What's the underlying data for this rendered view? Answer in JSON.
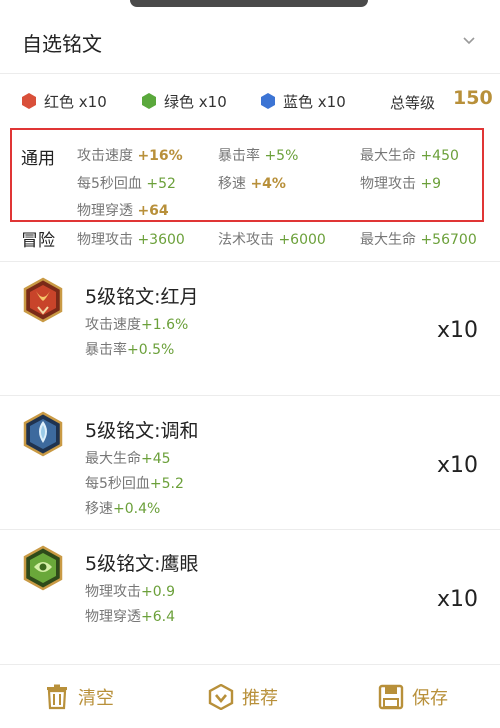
{
  "header": {
    "title": "自选铭文"
  },
  "colors": [
    {
      "label": "红色 x10",
      "color": "#d9503a"
    },
    {
      "label": "绿色 x10",
      "color": "#5aa83c"
    },
    {
      "label": "蓝色 x10",
      "color": "#3c74d4"
    }
  ],
  "level": {
    "label": "总等级",
    "value": "150"
  },
  "general": {
    "title": "通用",
    "stats": [
      {
        "label": "攻击速度",
        "value": "+16%"
      },
      {
        "label": "暴击率",
        "value": "+5%"
      },
      {
        "label": "最大生命",
        "value": "+450"
      },
      {
        "label": "每5秒回血",
        "value": "+52"
      },
      {
        "label": "移速",
        "value": "+4%"
      },
      {
        "label": "物理攻击",
        "value": "+9"
      },
      {
        "label": "物理穿透",
        "value": "+64"
      }
    ]
  },
  "adventure": {
    "title": "冒险",
    "stats": [
      {
        "label": "物理攻击",
        "value": "+3600"
      },
      {
        "label": "法术攻击",
        "value": "+6000"
      },
      {
        "label": "最大生命",
        "value": "+56700"
      }
    ]
  },
  "runes": [
    {
      "name": "5级铭文:红月",
      "count": "x10",
      "attrs": [
        {
          "label": "攻击速度",
          "value": "+1.6%"
        },
        {
          "label": "暴击率",
          "value": "+0.5%"
        }
      ]
    },
    {
      "name": "5级铭文:调和",
      "count": "x10",
      "attrs": [
        {
          "label": "最大生命",
          "value": "+45"
        },
        {
          "label": "每5秒回血",
          "value": "+5.2"
        },
        {
          "label": "移速",
          "value": "+0.4%"
        }
      ]
    },
    {
      "name": "5级铭文:鹰眼",
      "count": "x10",
      "attrs": [
        {
          "label": "物理攻击",
          "value": "+0.9"
        },
        {
          "label": "物理穿透",
          "value": "+6.4"
        }
      ]
    }
  ],
  "footer": {
    "clear": "清空",
    "recommend": "推荐",
    "save": "保存"
  }
}
